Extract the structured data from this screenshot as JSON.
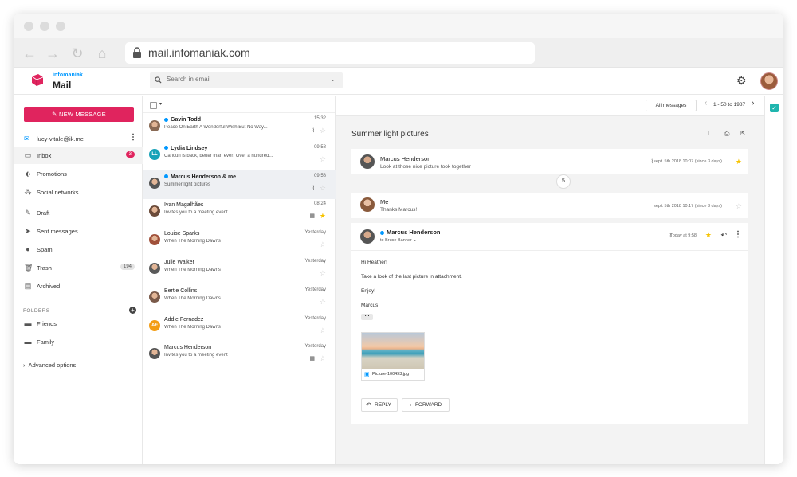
{
  "browser": {
    "url": "mail.infomaniak.com"
  },
  "app": {
    "brand_small": "infomaniak",
    "brand_title": "Mail"
  },
  "search": {
    "placeholder": "Search in email"
  },
  "sidebar": {
    "new_message": "NEW MESSAGE",
    "account": "lucy-vitale@ik.me",
    "items": [
      {
        "label": "Inbox",
        "icon": "inbox-icon",
        "count": "3"
      },
      {
        "label": "Promotions",
        "icon": "tag-icon"
      },
      {
        "label": "Social networks",
        "icon": "social-icon"
      },
      {
        "label": "Draft",
        "icon": "draft-icon"
      },
      {
        "label": "Sent messages",
        "icon": "send-icon"
      },
      {
        "label": "Spam",
        "icon": "spam-icon"
      },
      {
        "label": "Trash",
        "icon": "trash-icon",
        "count": "194"
      },
      {
        "label": "Archived",
        "icon": "archive-icon"
      }
    ],
    "folders_header": "FOLDERS",
    "folders": [
      {
        "label": "Friends"
      },
      {
        "label": "Family"
      }
    ],
    "advanced": "Advanced options"
  },
  "list": {
    "rows": [
      {
        "from": "Gavin Todd",
        "preview": "Peace On Earth A Wonderful Wish But No Way...",
        "time": "15:32",
        "unread": true,
        "avatar_color": "#8a6a55"
      },
      {
        "from": "Lydia Lindsey",
        "preview": "Cancun is back, better than ever! Over a hundred...",
        "time": "09:58",
        "unread": true,
        "initials": "LL",
        "avatar_color": "#17a2b8"
      },
      {
        "from": "Marcus Henderson & me",
        "preview": "Summer light pictures",
        "time": "09:58",
        "unread": true,
        "avatar_color": "#555555"
      },
      {
        "from": "Ivan Magalhães",
        "preview": "Invites you to a meeting event",
        "time": "08:24",
        "unread": false,
        "avatar_color": "#6b4b3a"
      },
      {
        "from": "Louise Sparks",
        "preview": "When The Morning Dawns",
        "time": "Yesterday",
        "unread": false,
        "avatar_color": "#a0503a"
      },
      {
        "from": "Julie Walker",
        "preview": "When The Morning Dawns",
        "time": "Yesterday",
        "unread": false,
        "avatar_color": "#5a5a5a"
      },
      {
        "from": "Bertie Collins",
        "preview": "When The Morning Dawns",
        "time": "Yesterday",
        "unread": false,
        "avatar_color": "#7a5a4a"
      },
      {
        "from": "Addie Fernadez",
        "preview": "When The Morning Dawns",
        "time": "Yesterday",
        "unread": false,
        "initials": "AF",
        "avatar_color": "#f39c12"
      },
      {
        "from": "Marcus Henderson",
        "preview": "Invites you to a meeting event",
        "time": "Yesterday",
        "unread": false,
        "avatar_color": "#555555"
      }
    ]
  },
  "reading": {
    "filter": "All messages",
    "pager": "1 - 50 to 1987",
    "subject": "Summer light pictures",
    "collapsed_count": "5",
    "messages": [
      {
        "from": "Marcus Henderson",
        "preview": "Look at those nice picture took together",
        "date": "sept. 5th 2018 10:07 (since 3 days)"
      },
      {
        "from": "Me",
        "preview": "Thanks Marcus!",
        "date": "sept. 5th 2018 10:17 (since 3 days)"
      }
    ],
    "open": {
      "from": "Marcus Henderson",
      "to": "to Bruce Banner",
      "date": "Today at 9:58",
      "body": [
        "Hi Heather!",
        "Take a look of the last picture in attachment.",
        "Enjoy!",
        "Marcus"
      ],
      "attachment": "Picture-100493.jpg",
      "reply": "REPLY",
      "forward": "FORWARD"
    }
  }
}
